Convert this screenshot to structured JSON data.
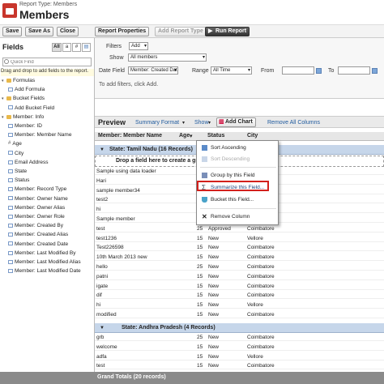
{
  "header": {
    "report_type": "Report Type: Members",
    "title": "Members"
  },
  "toolbar": {
    "save": "Save",
    "save_as": "Save As",
    "close": "Close",
    "report_properties": "Report Properties",
    "add_report_type": "Add Report Type",
    "run_report": "Run Report"
  },
  "fields_panel": {
    "title": "Fields",
    "tab_all": "All",
    "tab_text": "a",
    "tab_num": "#",
    "tab_date": "▤",
    "search_placeholder": "Quick Find",
    "drag_tip": "Drag and drop to add fields to the report.",
    "items": [
      {
        "label": "Formulas",
        "kind": "folder",
        "indent": 0
      },
      {
        "label": "Add Formula",
        "kind": "field",
        "indent": 1
      },
      {
        "label": "Bucket Fields",
        "kind": "folder",
        "indent": 0
      },
      {
        "label": "Add Bucket Field",
        "kind": "field",
        "indent": 1
      },
      {
        "label": "Member: Info",
        "kind": "folder",
        "indent": 0
      },
      {
        "label": "Member: ID",
        "kind": "field",
        "indent": 1
      },
      {
        "label": "Member: Member Name",
        "kind": "field",
        "indent": 1
      },
      {
        "label": "Age",
        "kind": "hash",
        "indent": 1
      },
      {
        "label": "City",
        "kind": "field",
        "indent": 1
      },
      {
        "label": "Email Address",
        "kind": "field",
        "indent": 1
      },
      {
        "label": "State",
        "kind": "field",
        "indent": 1
      },
      {
        "label": "Status",
        "kind": "field",
        "indent": 1
      },
      {
        "label": "Member: Record Type",
        "kind": "field",
        "indent": 1
      },
      {
        "label": "Member: Owner Name",
        "kind": "field",
        "indent": 1
      },
      {
        "label": "Member: Owner Alias",
        "kind": "field",
        "indent": 1
      },
      {
        "label": "Member: Owner Role",
        "kind": "field",
        "indent": 1
      },
      {
        "label": "Member: Created By",
        "kind": "field",
        "indent": 1
      },
      {
        "label": "Member: Created Alias",
        "kind": "field",
        "indent": 1
      },
      {
        "label": "Member: Created Date",
        "kind": "field",
        "indent": 1
      },
      {
        "label": "Member: Last Modified By",
        "kind": "field",
        "indent": 1
      },
      {
        "label": "Member: Last Modified Alias",
        "kind": "field",
        "indent": 1
      },
      {
        "label": "Member: Last Modified Date",
        "kind": "field",
        "indent": 1
      }
    ]
  },
  "filters": {
    "filters_label": "Filters",
    "add_value": "Add",
    "show_label": "Show",
    "show_value": "All members",
    "date_field_label": "Date Field",
    "date_field_value": "Member: Created Dat",
    "range_label": "Range",
    "range_value": "All Time",
    "from_label": "From",
    "to_label": "To",
    "hint": "To add filters, click Add."
  },
  "preview": {
    "title": "Preview",
    "summary_format": "Summary Format",
    "show": "Show",
    "add_chart": "Add Chart",
    "remove_all": "Remove All Columns",
    "columns": [
      "Member: Member Name",
      "Age",
      "Status",
      "City"
    ],
    "drop_zone": "Drop a field here to create a gr",
    "group1": "State: Tamil Nadu (16 Records)",
    "group2": "State: Andhra Pradesh (4 Records)",
    "grand_total": "Grand Totals (20 records)",
    "rows_g1": [
      {
        "name": "Sample using data loader",
        "age": "",
        "status": "",
        "city": ""
      },
      {
        "name": "Hari",
        "age": "",
        "status": "",
        "city": ""
      },
      {
        "name": "sample member34",
        "age": "",
        "status": "",
        "city": ""
      },
      {
        "name": "test2",
        "age": "",
        "status": "",
        "city": ""
      },
      {
        "name": "hi",
        "age": "",
        "status": "",
        "city": ""
      },
      {
        "name": "Sample member",
        "age": "",
        "status": "",
        "city": ""
      },
      {
        "name": "test",
        "age": "25",
        "status": "Approved",
        "city": "Coimbatore"
      },
      {
        "name": "test1236",
        "age": "15",
        "status": "New",
        "city": "Vellore"
      },
      {
        "name": "Test226598",
        "age": "15",
        "status": "New",
        "city": "Coimbatore"
      },
      {
        "name": "10th March 2013 new",
        "age": "15",
        "status": "New",
        "city": "Coimbatore"
      },
      {
        "name": "hello",
        "age": "25",
        "status": "New",
        "city": "Coimbatore"
      },
      {
        "name": "patni",
        "age": "15",
        "status": "New",
        "city": "Coimbatore"
      },
      {
        "name": "igate",
        "age": "15",
        "status": "New",
        "city": "Coimbatore"
      },
      {
        "name": "dif",
        "age": "15",
        "status": "New",
        "city": "Coimbatore"
      },
      {
        "name": "hi",
        "age": "15",
        "status": "New",
        "city": "Vellore"
      },
      {
        "name": "modified",
        "age": "15",
        "status": "New",
        "city": "Coimbatore"
      }
    ],
    "rows_g2": [
      {
        "name": "grb",
        "age": "25",
        "status": "New",
        "city": "Coimbatore"
      },
      {
        "name": "welcome",
        "age": "15",
        "status": "New",
        "city": "Coimbatore"
      },
      {
        "name": "adfa",
        "age": "15",
        "status": "New",
        "city": "Vellore"
      },
      {
        "name": "test",
        "age": "15",
        "status": "New",
        "city": "Coimbatore"
      }
    ]
  },
  "context_menu": {
    "sort_asc": "Sort Ascending",
    "sort_desc": "Sort Descending",
    "group_by": "Group by this Field",
    "summarize": "Summarize this Field...",
    "bucket": "Bucket this Field...",
    "remove": "Remove Column"
  },
  "colors": {
    "highlight": "#d3201c",
    "group_bg": "#c6d6ea",
    "link": "#1f5a9e"
  }
}
